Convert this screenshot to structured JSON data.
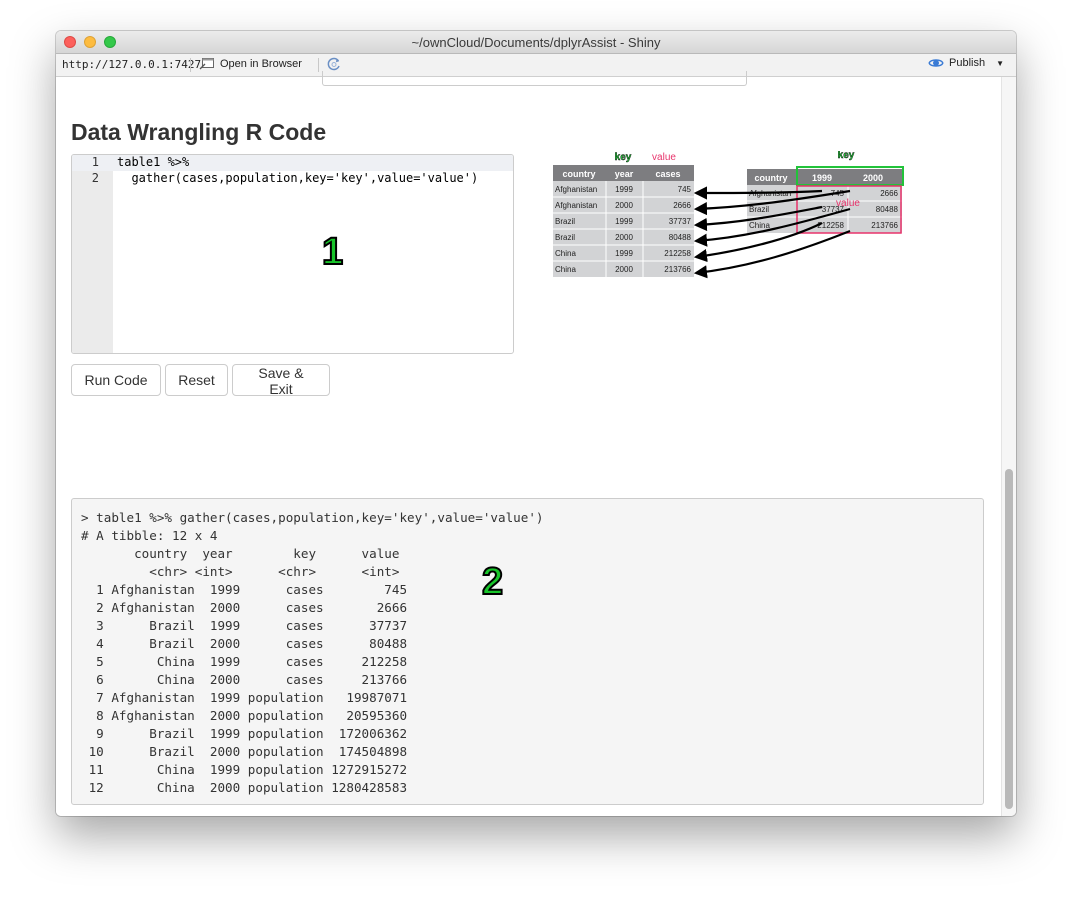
{
  "window": {
    "title": "~/ownCloud/Documents/dplyrAssist - Shiny"
  },
  "toolbar": {
    "url": "http://127.0.0.1:7427",
    "open_browser": "Open in Browser",
    "publish": "Publish"
  },
  "main": {
    "heading": "Data Wrangling R Code",
    "annotation1": "1",
    "annotation2": "2"
  },
  "editor": {
    "lines": [
      {
        "num": "1",
        "text": "table1 %>%"
      },
      {
        "num": "2",
        "text": "  gather(cases,population,key='key',value='value')"
      }
    ]
  },
  "buttons": {
    "run": "Run Code",
    "reset": "Reset",
    "save_exit": "Save & Exit"
  },
  "output": {
    "text": "> table1 %>% gather(cases,population,key='key',value='value')\n# A tibble: 12 x 4\n       country  year        key      value\n         <chr> <int>      <chr>      <int>\n  1 Afghanistan  1999      cases        745\n  2 Afghanistan  2000      cases       2666\n  3      Brazil  1999      cases      37737\n  4      Brazil  2000      cases      80488\n  5       China  1999      cases     212258\n  6       China  2000      cases     213766\n  7 Afghanistan  1999 population   19987071\n  8 Afghanistan  2000 population   20595360\n  9      Brazil  1999 population  172006362\n 10      Brazil  2000 population  174504898\n 11       China  1999 population 1272915272\n 12       China  2000 population 1280428583"
  },
  "diagram": {
    "left_key_label": "key",
    "left_value_label": "value",
    "left_headers": [
      "country",
      "year",
      "cases"
    ],
    "left_rows": [
      [
        "Afghanistan",
        "1999",
        "745"
      ],
      [
        "Afghanistan",
        "2000",
        "2666"
      ],
      [
        "Brazil",
        "1999",
        "37737"
      ],
      [
        "Brazil",
        "2000",
        "80488"
      ],
      [
        "China",
        "1999",
        "212258"
      ],
      [
        "China",
        "2000",
        "213766"
      ]
    ],
    "right_key_label": "key",
    "right_value_label": "value",
    "right_headers": [
      "country",
      "1999",
      "2000"
    ],
    "right_rows": [
      [
        "Afghanistan",
        "745",
        "2666"
      ],
      [
        "Brazil",
        "37737",
        "80488"
      ],
      [
        "China",
        "212258",
        "213766"
      ]
    ],
    "colors": {
      "key": "#22c33a",
      "value": "#e8336b",
      "header": "#7d7d80",
      "cell": "#d2d3d5"
    }
  }
}
